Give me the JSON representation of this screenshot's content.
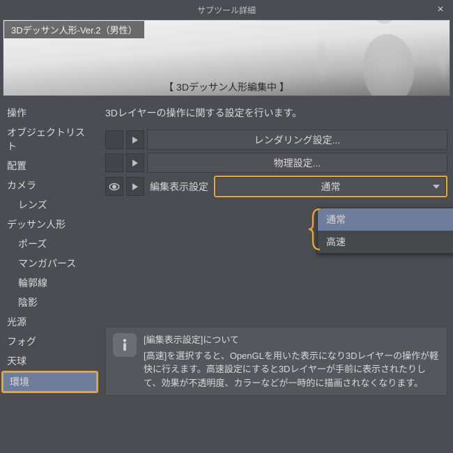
{
  "window": {
    "title": "サブツール詳細"
  },
  "banner": {
    "title": "3Dデッサン人形-Ver.2（男性）",
    "subtitle": "【 3Dデッサン人形編集中 】"
  },
  "sidebar": {
    "items": [
      {
        "label": "操作",
        "indent": 0
      },
      {
        "label": "オブジェクトリスト",
        "indent": 0
      },
      {
        "label": "配置",
        "indent": 0
      },
      {
        "label": "カメラ",
        "indent": 0
      },
      {
        "label": "レンズ",
        "indent": 1
      },
      {
        "label": "デッサン人形",
        "indent": 0
      },
      {
        "label": "ポーズ",
        "indent": 1
      },
      {
        "label": "マンガパース",
        "indent": 1
      },
      {
        "label": "輪郭線",
        "indent": 1
      },
      {
        "label": "陰影",
        "indent": 1
      },
      {
        "label": "光源",
        "indent": 0
      },
      {
        "label": "フォグ",
        "indent": 0
      },
      {
        "label": "天球",
        "indent": 0
      },
      {
        "label": "環境",
        "indent": 0,
        "selected": true,
        "highlight": true
      }
    ]
  },
  "main": {
    "desc": "3Dレイヤーの操作に関する設定を行います。",
    "rendering_btn": "レンダリング設定...",
    "physics_btn": "物理設定...",
    "display_label": "編集表示設定",
    "display_value": "通常",
    "dropdown": {
      "options": [
        "通常",
        "高速"
      ],
      "selected": 0
    },
    "info": {
      "heading": "[編集表示設定]について",
      "body": "[高速]を選択すると、OpenGLを用いた表示になり3Dレイヤーの操作が軽快に行えます。高速設定にすると3Dレイヤーが手前に表示されたりして、効果が不透明度、カラーなどが一時的に描画されなくなります。"
    }
  }
}
